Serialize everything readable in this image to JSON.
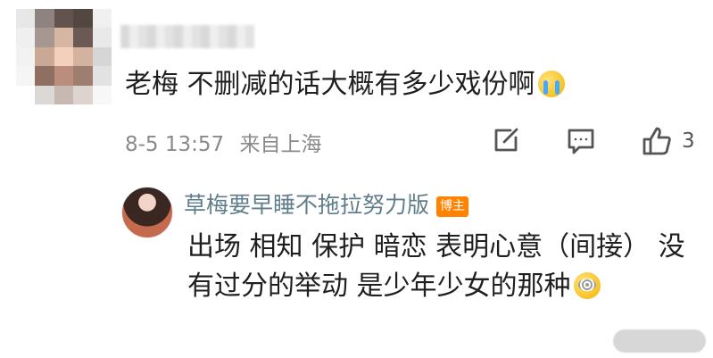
{
  "comment": {
    "text": "老梅 不删减的话大概有多少戏份啊",
    "emoji": "loudly-crying-face",
    "timestamp": "8-5 13:57",
    "location": "来自上海",
    "likes": "3"
  },
  "reply": {
    "author": "草梅要早睡不拖拉努力版",
    "badge": "博主",
    "text": "出场 相知 保护 暗恋 表明心意（间接） 没有过分的举动 是少年少女的那种",
    "emoji": "dizzy-face"
  },
  "colors": {
    "name": "#607d8b",
    "meta": "#8a8a8a",
    "badge": "#ff8200"
  },
  "icons": {
    "share": "edit-share-icon",
    "comment": "comment-icon",
    "like": "thumbs-up-icon"
  }
}
